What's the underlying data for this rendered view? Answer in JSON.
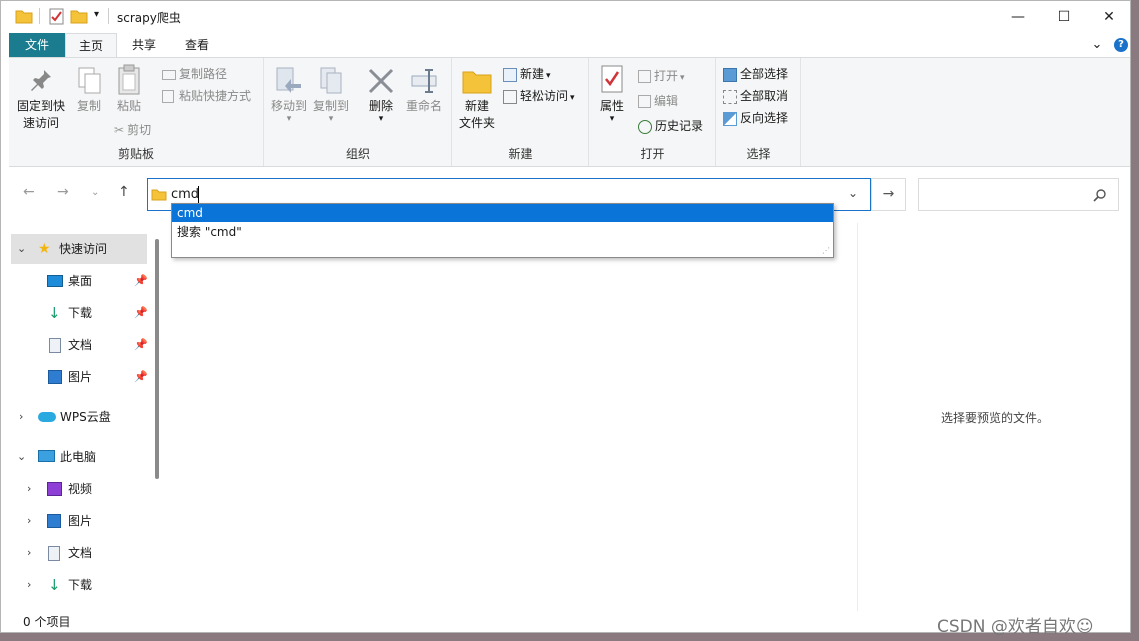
{
  "window": {
    "title": "scrapy爬虫",
    "minimize": "—",
    "maximize": "☐",
    "close": "✕"
  },
  "tabs": {
    "file": "文件",
    "home": "主页",
    "share": "共享",
    "view": "查看",
    "expand": "⌄",
    "help": "?"
  },
  "ribbon": {
    "clipboard": {
      "label": "剪贴板",
      "pin_l1": "固定到快",
      "pin_l2": "速访问",
      "copy": "复制",
      "paste": "粘贴",
      "copy_path": "复制路径",
      "paste_shortcut": "粘贴快捷方式",
      "cut": "剪切"
    },
    "organize": {
      "label": "组织",
      "move_to": "移动到",
      "copy_to": "复制到",
      "delete": "删除",
      "rename": "重命名"
    },
    "new": {
      "label": "新建",
      "new_folder_l1": "新建",
      "new_folder_l2": "文件夹",
      "new_item": "新建",
      "easy_access": "轻松访问"
    },
    "open": {
      "label": "打开",
      "properties": "属性",
      "open": "打开",
      "edit": "编辑",
      "history": "历史记录"
    },
    "select": {
      "label": "选择",
      "select_all": "全部选择",
      "select_none": "全部取消",
      "invert": "反向选择"
    }
  },
  "address": {
    "value": "cmd"
  },
  "autocomplete": {
    "items": [
      "cmd",
      "搜索 \"cmd\""
    ]
  },
  "sidebar": {
    "quick_access": "快速访问",
    "desktop": "桌面",
    "downloads": "下载",
    "documents": "文档",
    "pictures": "图片",
    "wps": "WPS云盘",
    "this_pc": "此电脑",
    "pc_videos": "视频",
    "pc_pictures": "图片",
    "pc_documents": "文档",
    "pc_downloads": "下载"
  },
  "preview": {
    "message": "选择要预览的文件。"
  },
  "status": {
    "count": "0 个项目"
  },
  "watermark": "CSDN @欢者自欢☺"
}
